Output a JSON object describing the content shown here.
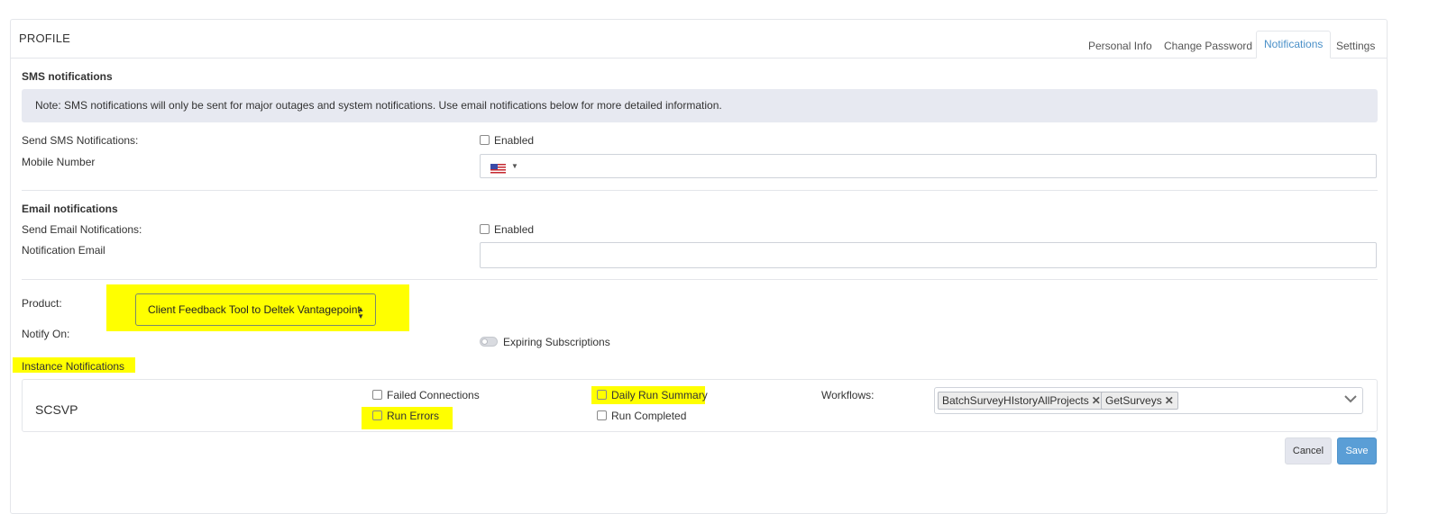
{
  "profile": {
    "title": "PROFILE",
    "tabs": [
      {
        "label": "Personal Info",
        "active": false
      },
      {
        "label": "Change Password",
        "active": false
      },
      {
        "label": "Notifications",
        "active": true
      },
      {
        "label": "Settings",
        "active": false
      }
    ]
  },
  "sms": {
    "section_title": "SMS notifications",
    "note": "Note: SMS notifications will only be sent for major outages and system notifications. Use email notifications below for more detailed information.",
    "send_label": "Send SMS Notifications:",
    "enabled_label": "Enabled",
    "mobile_label": "Mobile Number",
    "mobile_value": "",
    "country_icon": "us-flag-icon"
  },
  "email": {
    "section_title": "Email notifications",
    "send_label": "Send Email Notifications:",
    "enabled_label": "Enabled",
    "email_label": "Notification Email",
    "email_value": ""
  },
  "product": {
    "label": "Product:",
    "selected": "Client Feedback Tool to Deltek Vantagepoint"
  },
  "notify": {
    "label": "Notify On:",
    "toggle_label": "Expiring Subscriptions",
    "toggle_on": false
  },
  "instance": {
    "section_label": "Instance Notifications",
    "name": "SCSVP",
    "options": {
      "failed_connections": "Failed Connections",
      "run_errors": "Run Errors",
      "daily_run_summary": "Daily Run Summary",
      "run_completed": "Run Completed"
    },
    "workflows_label": "Workflows:",
    "workflows": [
      "BatchSurveyHIstoryAllProjects",
      "GetSurveys"
    ]
  },
  "actions": {
    "cancel_label": "Cancel",
    "save_label": "Save"
  },
  "colors": {
    "highlight": "#ffff00",
    "active_tab": "#4a90c8",
    "save_button": "#5a9ed6",
    "note_bg": "#e7e9f1"
  }
}
